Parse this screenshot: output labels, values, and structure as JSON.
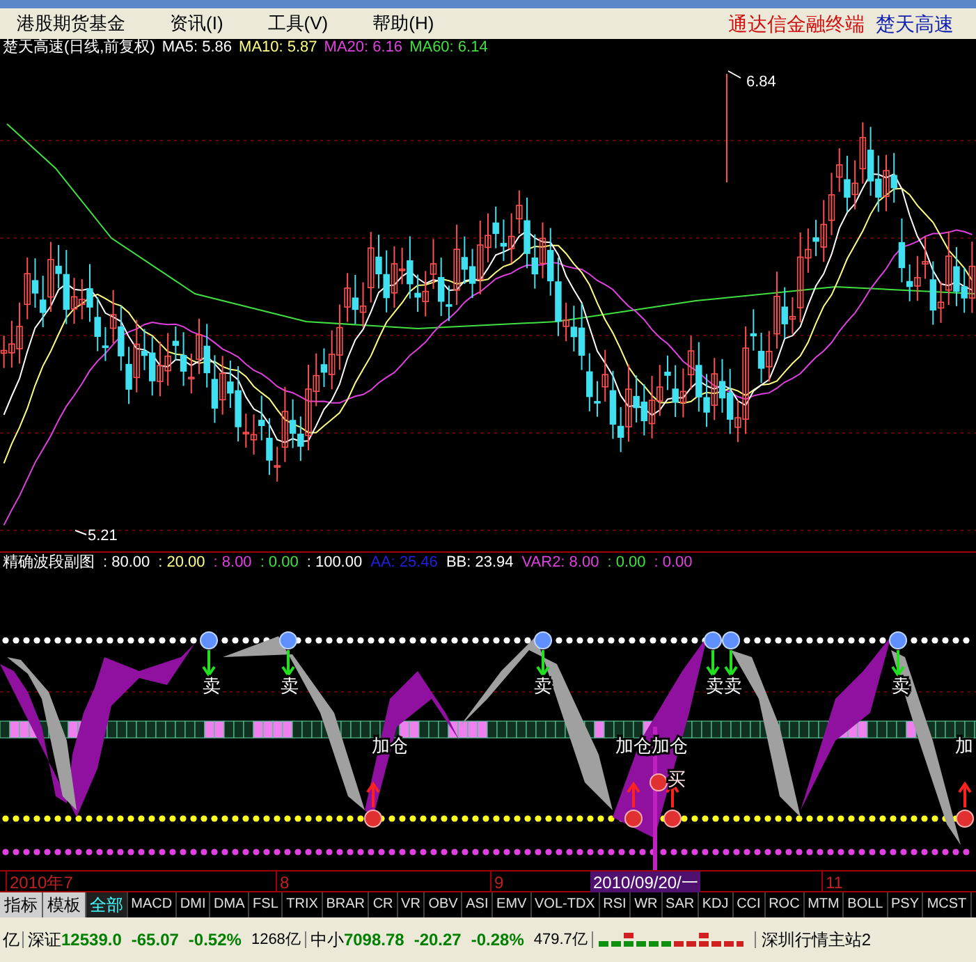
{
  "menu_bar": {
    "items": [
      {
        "label": "港股期货基金"
      },
      {
        "label": "资讯(I)"
      },
      {
        "label": "工具(V)"
      },
      {
        "label": "帮助(H)"
      }
    ],
    "app_title": "通达信金融终端",
    "stock_name": "楚天高速"
  },
  "price_chart": {
    "legend": [
      {
        "text": "楚天高速(日线,前复权)",
        "color": "#ffffff"
      },
      {
        "text": "MA5: 5.86",
        "color": "#ffffff"
      },
      {
        "text": "MA10: 5.87",
        "color": "#ffff80"
      },
      {
        "text": "MA20: 6.16",
        "color": "#e040e0"
      },
      {
        "text": "MA60: 6.14",
        "color": "#40e040"
      }
    ],
    "high_label": "6.84",
    "low_label": "5.21"
  },
  "indicator": {
    "legend": [
      {
        "text": "精确波段副图",
        "color": "#ffffff"
      },
      {
        "text": ": 80.00",
        "color": "#ffffff"
      },
      {
        "text": ": 20.00",
        "color": "#ffff80"
      },
      {
        "text": ": 8.00",
        "color": "#e040e0"
      },
      {
        "text": ": 0.00",
        "color": "#40e040"
      },
      {
        "text": ": 100.00",
        "color": "#ffffff"
      },
      {
        "text": "AA: 25.46",
        "color": "#2020e0"
      },
      {
        "text": "BB: 23.94",
        "color": "#ffffff"
      },
      {
        "text": "VAR2: 8.00",
        "color": "#e040e0"
      },
      {
        "text": ": 0.00",
        "color": "#40e040"
      },
      {
        "text": ": 0.00",
        "color": "#e040e0"
      }
    ],
    "signals": [
      {
        "kind": "sell",
        "text": "卖"
      },
      {
        "kind": "sell",
        "text": "卖"
      },
      {
        "kind": "add",
        "text": "加仓"
      },
      {
        "kind": "sell",
        "text": "卖"
      },
      {
        "kind": "add",
        "text": "加仓加仓"
      },
      {
        "kind": "sell",
        "text": "卖卖"
      },
      {
        "kind": "sell",
        "text": "卖"
      },
      {
        "kind": "add",
        "text": "加"
      },
      {
        "kind": "buy",
        "text": "买"
      }
    ]
  },
  "date_axis": [
    {
      "label": "2010年7",
      "selected": false
    },
    {
      "label": "8",
      "selected": false
    },
    {
      "label": "9",
      "selected": false
    },
    {
      "label": "2010/09/20/一",
      "selected": true
    },
    {
      "label": "11",
      "selected": false
    }
  ],
  "tabs": [
    {
      "label": "指标",
      "kind": "button",
      "selected": false
    },
    {
      "label": "模板",
      "kind": "button",
      "selected": false
    },
    {
      "label": "全部",
      "kind": "tab",
      "selected": true
    },
    {
      "label": "MACD",
      "kind": "tab",
      "selected": false
    },
    {
      "label": "DMI",
      "kind": "tab",
      "selected": false
    },
    {
      "label": "DMA",
      "kind": "tab",
      "selected": false
    },
    {
      "label": "FSL",
      "kind": "tab",
      "selected": false
    },
    {
      "label": "TRIX",
      "kind": "tab",
      "selected": false
    },
    {
      "label": "BRAR",
      "kind": "tab",
      "selected": false
    },
    {
      "label": "CR",
      "kind": "tab",
      "selected": false
    },
    {
      "label": "VR",
      "kind": "tab",
      "selected": false
    },
    {
      "label": "OBV",
      "kind": "tab",
      "selected": false
    },
    {
      "label": "ASI",
      "kind": "tab",
      "selected": false
    },
    {
      "label": "EMV",
      "kind": "tab",
      "selected": false
    },
    {
      "label": "VOL-TDX",
      "kind": "tab",
      "selected": false
    },
    {
      "label": "RSI",
      "kind": "tab",
      "selected": false
    },
    {
      "label": "WR",
      "kind": "tab",
      "selected": false
    },
    {
      "label": "SAR",
      "kind": "tab",
      "selected": false
    },
    {
      "label": "KDJ",
      "kind": "tab",
      "selected": false
    },
    {
      "label": "CCI",
      "kind": "tab",
      "selected": false
    },
    {
      "label": "ROC",
      "kind": "tab",
      "selected": false
    },
    {
      "label": "MTM",
      "kind": "tab",
      "selected": false
    },
    {
      "label": "BOLL",
      "kind": "tab",
      "selected": false
    },
    {
      "label": "PSY",
      "kind": "tab",
      "selected": false
    },
    {
      "label": "MCST",
      "kind": "tab",
      "selected": false
    }
  ],
  "status_bar": {
    "lead": "亿",
    "markets": [
      {
        "name": "深证",
        "index": "12539.0",
        "change": "-65.07",
        "percent": "-0.52%",
        "volume": "1268亿"
      },
      {
        "name": "中小",
        "index": "7098.78",
        "change": "-20.27",
        "percent": "-0.28%",
        "volume": "479.7亿"
      }
    ],
    "server": "深圳行情主站2"
  }
}
